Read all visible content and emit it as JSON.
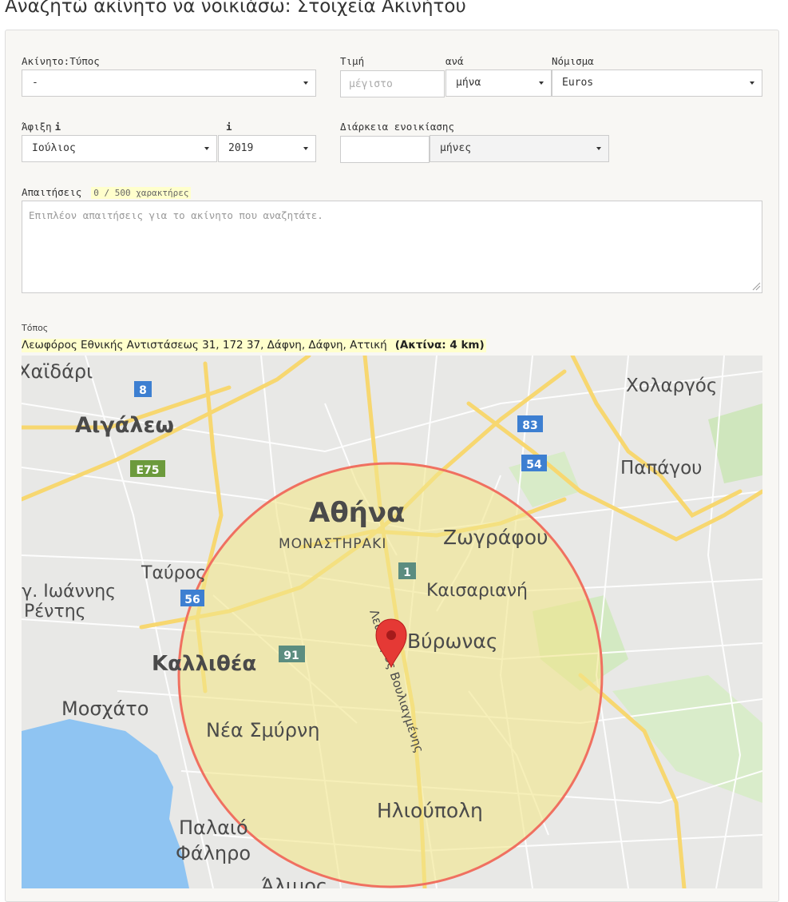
{
  "page": {
    "title": "Αναζητώ ακίνητο να νοικιάσω: Στοιχεία Ακινήτου"
  },
  "form": {
    "property_type": {
      "label": "Ακίνητο:Τύπος",
      "value": "-"
    },
    "price": {
      "label": "Τιμή",
      "placeholder": "μέγιστο"
    },
    "per": {
      "label": "ανά",
      "value": "μήνα"
    },
    "currency": {
      "label": "Νόμισμα",
      "value": "Euros"
    },
    "arrival": {
      "label": "Άφιξη",
      "info_icon": "i",
      "month": "Ιούλιος",
      "year_info_icon": "i",
      "year": "2019"
    },
    "duration": {
      "label": "Διάρκεια ενοικίασης",
      "unit": "μήνες"
    },
    "requirements": {
      "label": "Απαιτήσεις",
      "counter": "0 / 500 χαρακτήρες",
      "placeholder": "Επιπλέον απαιτήσεις για το ακίνητο που αναζητάτε."
    },
    "location": {
      "label": "Τόπος",
      "address": "Λεωφόρος Εθνικής Αντιστάσεως 31, 172 37, Δάφνη, Δάφνη, Αττική",
      "radius": "(Ακτίνα:  4 km)"
    }
  },
  "map": {
    "places": [
      "Χαϊδάρι",
      "Αιγάλεω",
      "Χολαργός",
      "Παπάγου",
      "Αθήνα",
      "ΜΟΝΑΣΤΗΡΑΚΙ",
      "Ζωγράφου",
      "Ταύρος",
      "Καισαριανή",
      "Άγ. Ιωάννης",
      "Ρέντης",
      "Βύρωνας",
      "Καλλιθέα",
      "Μοσχάτο",
      "Νέα Σμύρνη",
      "Ηλιούπολη",
      "Παλαιό",
      "Φάληρο",
      "Άλιμος"
    ],
    "road_label": "Λεωφόρος Βουλιαγμένης",
    "shields": [
      "8",
      "83",
      "E75",
      "54",
      "1",
      "56",
      "91"
    ],
    "colors": {
      "circle_fill": "#f2e68a",
      "circle_stroke": "#f07060",
      "marker": "#e53935",
      "sea": "#8fc4f2",
      "road": "#ffffff",
      "highway": "#f7d770"
    }
  }
}
